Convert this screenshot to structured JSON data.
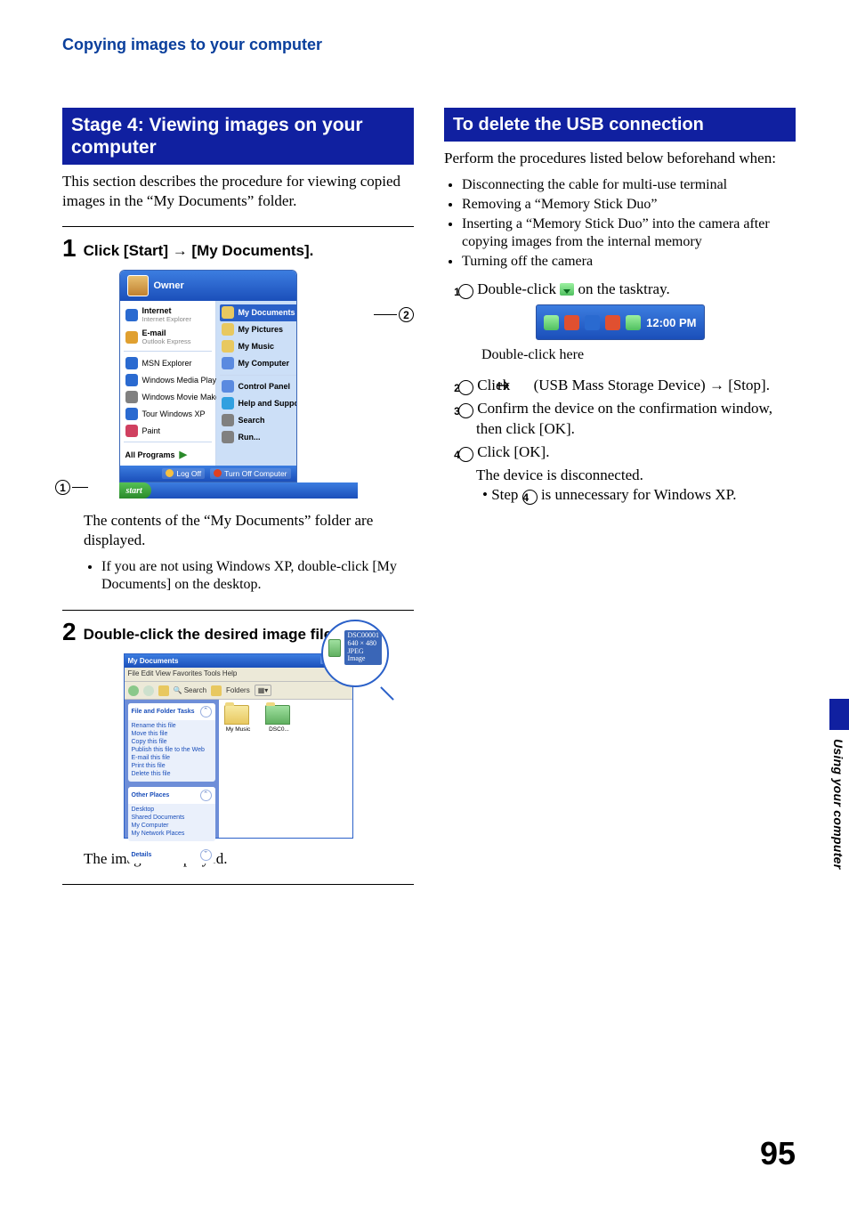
{
  "running_head": "Copying images to your computer",
  "page_number": "95",
  "side_label": "Using your computer",
  "left": {
    "heading": "Stage 4: Viewing images on your computer",
    "intro": "This section describes the procedure for viewing copied images in the “My Documents” folder.",
    "step1_num": "1",
    "step1_title": "Click [Start] → [My Documents].",
    "step1_after": "The contents of the “My Documents” folder are displayed.",
    "step1_note": "If you are not using Windows XP, double-click [My Documents] on the desktop.",
    "step2_num": "2",
    "step2_title": "Double-click the desired image file.",
    "step2_after": "The image is displayed.",
    "start_menu": {
      "user": "Owner",
      "left_items": [
        {
          "title": "Internet",
          "sub": "Internet Explorer",
          "icon": "#2a6ad0"
        },
        {
          "title": "E-mail",
          "sub": "Outlook Express",
          "icon": "#e0a030"
        },
        {
          "title": "MSN Explorer",
          "sub": "",
          "icon": "#2a6ad0"
        },
        {
          "title": "Windows Media Player",
          "sub": "",
          "icon": "#2a6ad0"
        },
        {
          "title": "Windows Movie Maker",
          "sub": "",
          "icon": "#808080"
        },
        {
          "title": "Tour Windows XP",
          "sub": "",
          "icon": "#2a6ad0"
        },
        {
          "title": "Paint",
          "sub": "",
          "icon": "#d04060"
        }
      ],
      "all_programs": "All Programs",
      "right_items": [
        {
          "label": "My Documents",
          "hi": true,
          "icon": "#e8c860"
        },
        {
          "label": "My Pictures",
          "hi": false,
          "icon": "#e8c860"
        },
        {
          "label": "My Music",
          "hi": false,
          "icon": "#e8c860"
        },
        {
          "label": "My Computer",
          "hi": false,
          "icon": "#5a8ae0"
        },
        {
          "label": "Control Panel",
          "hi": false,
          "icon": "#5a8ae0"
        },
        {
          "label": "Help and Support",
          "hi": false,
          "icon": "#30a0e0"
        },
        {
          "label": "Search",
          "hi": false,
          "icon": "#808080"
        },
        {
          "label": "Run...",
          "hi": false,
          "icon": "#808080"
        }
      ],
      "logoff": "Log Off",
      "turnoff": "Turn Off Computer",
      "start": "start"
    },
    "folder": {
      "title": "My Documents",
      "menus": "File   Edit   View   Favorites   Tools   Help",
      "tool_search": "Search",
      "tool_folders": "Folders",
      "panel1": {
        "head": "File and Folder Tasks",
        "items": [
          "Rename this file",
          "Move this file",
          "Copy this file",
          "Publish this file to the Web",
          "E-mail this file",
          "Print this file",
          "Delete this file"
        ]
      },
      "panel2": {
        "head": "Other Places",
        "items": [
          "Desktop",
          "Shared Documents",
          "My Computer",
          "My Network Places"
        ]
      },
      "panel3": {
        "head": "Details"
      },
      "thumb1": "My Music",
      "thumb2": "DSC0...",
      "mag": {
        "line1": "DSC00001",
        "line2": "640 × 480",
        "line3": "JPEG Image"
      }
    },
    "callouts": {
      "c1": "1",
      "c2": "2"
    }
  },
  "right": {
    "heading": "To delete the USB connection",
    "intro": "Perform the procedures listed below beforehand when:",
    "bullets": [
      "Disconnecting the cable for multi-use terminal",
      "Removing a “Memory Stick Duo”",
      "Inserting a “Memory Stick Duo” into the camera after copying images from the internal memory",
      "Turning off the camera"
    ],
    "enum1_pre": "Double-click ",
    "enum1_post": " on the tasktray.",
    "tasktray_time": "12:00 PM",
    "tasktray_caption": "Double-click here",
    "enum2_pre": "Click ",
    "enum2_post": " (USB Mass Storage Device) → [Stop].",
    "enum3": "Confirm the device on the confirmation window, then click [OK].",
    "enum4": "Click [OK].",
    "enum4_sub": "The device is disconnected.",
    "enum4_note_pre": "Step ",
    "enum4_note_post": " is unnecessary for Windows XP.",
    "nums": {
      "n1": "1",
      "n2": "2",
      "n3": "3",
      "n4": "4"
    }
  }
}
